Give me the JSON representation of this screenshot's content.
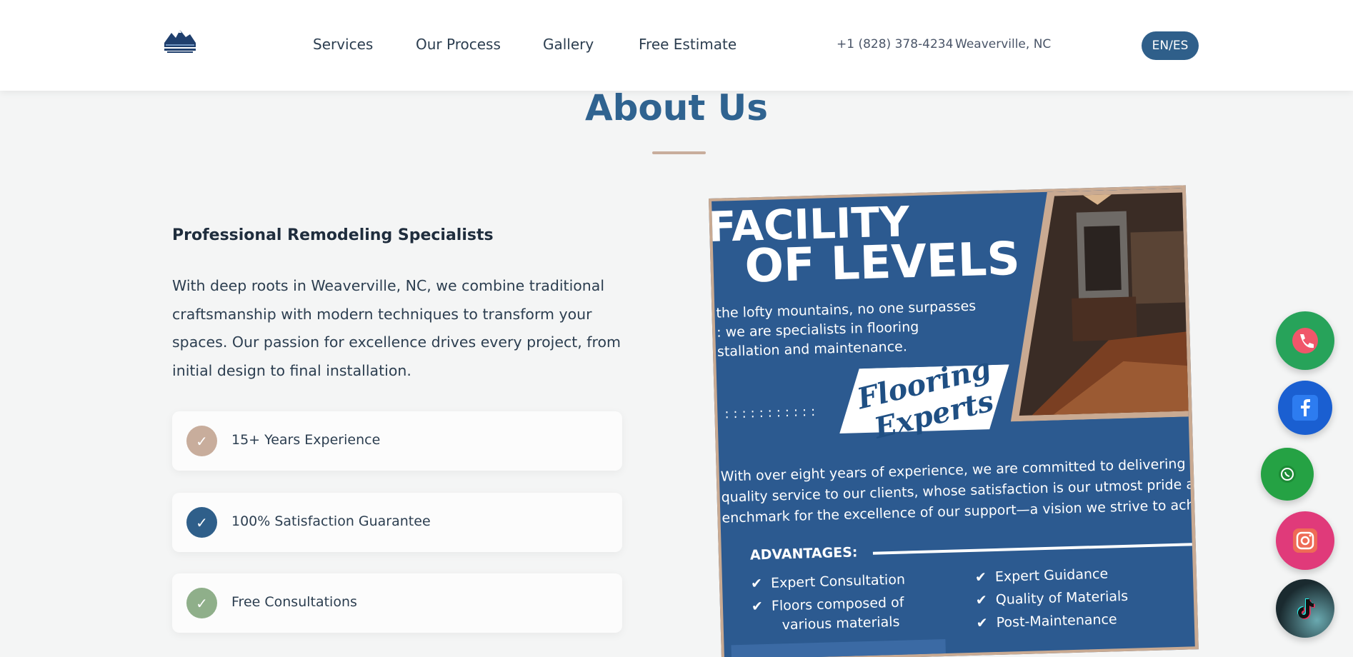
{
  "header": {
    "logo_alt": "High Mountain Remodeling LLC",
    "nav": [
      "Services",
      "Our Process",
      "Gallery",
      "Free Estimate"
    ],
    "phone": "+1 (828) 378-4234",
    "location": "Weaverville, NC",
    "lang_toggle": "EN/ES"
  },
  "about": {
    "title": "About Us",
    "subheading": "Professional Remodeling Specialists",
    "paragraph": "With deep roots in Weaverville, NC, we combine traditional craftsmanship with modern techniques to transform your spaces. Our passion for excellence drives every project, from initial design to final installation.",
    "features": [
      {
        "label": "15+ Years Experience",
        "color": "#c8ad9c"
      },
      {
        "label": "100% Satisfaction Guarantee",
        "color": "#2f5f8a"
      },
      {
        "label": "Free Consultations",
        "color": "#8faf8a"
      }
    ],
    "check_glyph": "✓"
  },
  "flyer": {
    "headline1": "FACILITY",
    "headline2": "OF LEVELS",
    "intro_line1": "the lofty mountains, no one surpasses",
    "intro_line2": ": we are specialists in flooring",
    "intro_line3": "stallation and maintenance.",
    "script1": "Flooring",
    "script2": "Experts",
    "body_line1": "With over eight years of experience, we are committed to delivering hig",
    "body_line2": "quality service to our clients, whose satisfaction is our utmost pride and c",
    "body_line3": "enchmark for the excellence of our support—a vision we strive to achiev",
    "advantages_title": "ADVANTAGES:",
    "advantages_left": [
      "Expert Consultation",
      "Floors composed of",
      "various materials"
    ],
    "advantages_right": [
      "Expert Guidance",
      "Quality of Materials",
      "Post-Maintenance"
    ]
  },
  "floating": [
    {
      "name": "phone",
      "color": "#27a35a"
    },
    {
      "name": "facebook",
      "color": "#1a5fd1"
    },
    {
      "name": "whatsapp",
      "color": "#25a244"
    },
    {
      "name": "instagram",
      "color": "#e03a7a"
    },
    {
      "name": "tiktok",
      "color": "#1a2a2f"
    }
  ]
}
